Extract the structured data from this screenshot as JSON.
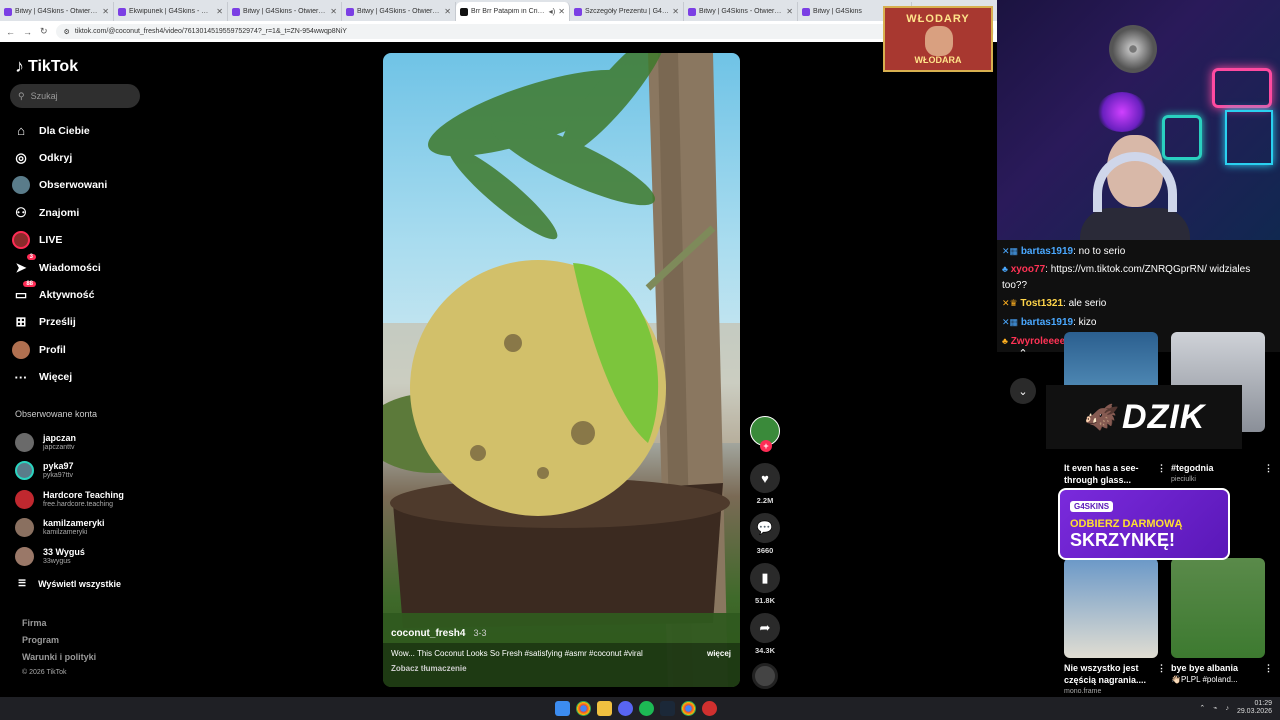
{
  "browser": {
    "tabs": [
      {
        "label": "Bitwy | G4Skins - Otwieraj sk",
        "type": "g4",
        "active": false
      },
      {
        "label": "Ekwipunek | G4Skins - Otwier",
        "type": "g4",
        "active": false
      },
      {
        "label": "Bitwy | G4Skins - Otwieraj sk",
        "type": "g4",
        "active": false
      },
      {
        "label": "Bitwy | G4Skins - Otwieraj sk",
        "type": "g4",
        "active": false
      },
      {
        "label": "Brr Brr Patapim in Crimon",
        "type": "tt",
        "active": true
      },
      {
        "label": "Szczegóły Prezentu | G4Skins",
        "type": "g4",
        "active": false
      },
      {
        "label": "Bitwy | G4Skins - Otwieraj sk",
        "type": "g4",
        "active": false
      },
      {
        "label": "Bitwy | G4Skins",
        "type": "g4",
        "active": false
      }
    ],
    "url": "tiktok.com/@coconut_fresh4/video/7613014519559752974?_r=1&_t=ZN-954wwqp8NiY"
  },
  "sidebar": {
    "brand": "TikTok",
    "search_placeholder": "Szukaj",
    "nav": [
      {
        "label": "Dla Ciebie",
        "icon": "home-icon"
      },
      {
        "label": "Odkryj",
        "icon": "compass-icon"
      },
      {
        "label": "Obserwowani",
        "icon": "avatar"
      },
      {
        "label": "Znajomi",
        "icon": "friends-icon"
      },
      {
        "label": "LIVE",
        "icon": "live-avatar"
      },
      {
        "label": "Wiadomości",
        "icon": "send-icon",
        "badge": "3"
      },
      {
        "label": "Aktywność",
        "icon": "inbox-icon",
        "badge": "88"
      },
      {
        "label": "Prześlij",
        "icon": "upload-icon"
      },
      {
        "label": "Profil",
        "icon": "profile-avatar"
      },
      {
        "label": "Więcej",
        "icon": "more-icon"
      }
    ],
    "followed_title": "Obserwowane konta",
    "accounts": [
      {
        "name": "japczan",
        "handle": "japczanttv"
      },
      {
        "name": "pyka97",
        "handle": "pyka97ttv"
      },
      {
        "name": "Hardcore Teaching",
        "handle": "free.hardcore.teaching"
      },
      {
        "name": "kamilzameryki",
        "handle": "kamilzameryki"
      },
      {
        "name": "33 Wyguś",
        "handle": "33wygus"
      }
    ],
    "show_all": "Wyświetl wszystkie",
    "footer": [
      "Firma",
      "Program",
      "Warunki i polityki"
    ],
    "copyright": "© 2026 TikTok"
  },
  "video": {
    "username": "coconut_fresh4",
    "date": "3-3",
    "description": "Wow... This Coconut Looks So Fresh #satisfying #asmr #coconut #viral",
    "more": "więcej",
    "translate": "Zobacz tłumaczenie"
  },
  "actions": {
    "likes": "2.2M",
    "comments": "3660",
    "saves": "51.8K",
    "shares": "34.3K"
  },
  "overlay": {
    "banner_top": "WŁODARY",
    "banner_bottom": "WŁODARA",
    "chat": [
      {
        "user": "bartas1919",
        "color": "#4aa8ff",
        "text": ": no to serio"
      },
      {
        "user": "xyoo77",
        "color": "#ff3355",
        "text": ": https://vm.tiktok.com/ZNRQGprRN/ widziales too??"
      },
      {
        "user": "Tost1321",
        "color": "#ffd54a",
        "text": ": ale serio"
      },
      {
        "user": "bartas1919",
        "color": "#4aa8ff",
        "text": ": kizo"
      },
      {
        "user": "Zwyroleeee",
        "color": "#ff3355",
        "text": ": 😎"
      }
    ],
    "dzik": "DZIK",
    "promo_brand": "G4SKINS",
    "promo_line1": "ODBIERZ DARMOWĄ",
    "promo_line2": "SKRZYNKĘ!"
  },
  "recommendations": [
    {
      "title": "It even has a see-through glass..."
    },
    {
      "title": "#tegodnia",
      "sub": "pieciulki"
    },
    {
      "title": "Nie wszystko jest częścią nagrania....",
      "sub": "mono.frame"
    },
    {
      "title": "bye bye albania",
      "sub": "👋🏻PLPL #poland..."
    }
  ],
  "taskbar": {
    "time": "01:29",
    "date": "29.03.2026"
  }
}
